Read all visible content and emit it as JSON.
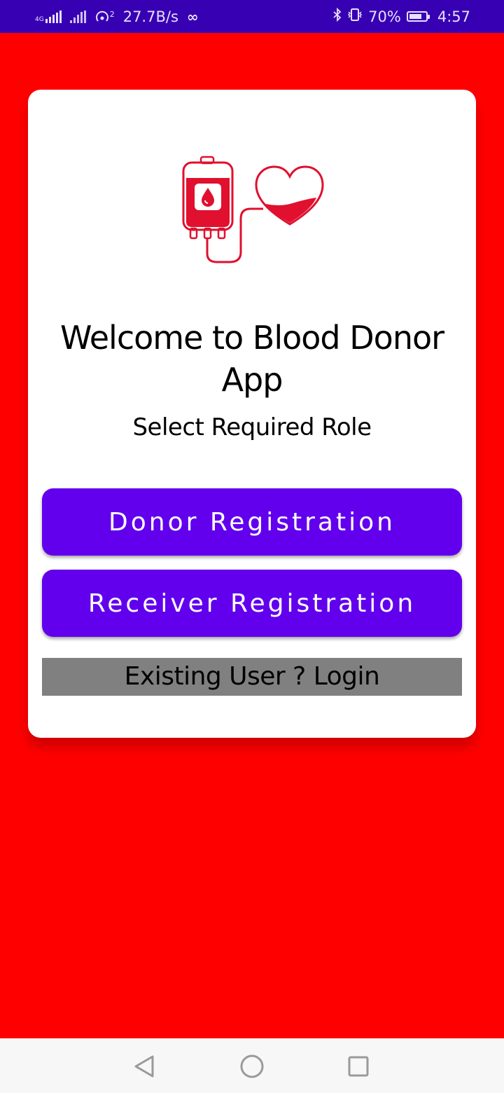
{
  "status_bar": {
    "network_type": "4G",
    "hotspot_count": "2",
    "speed": "27.7B/s",
    "battery": "70%",
    "time": "4:57",
    "icons": [
      "signal-icon",
      "signal-icon",
      "hotspot-icon",
      "infinity-icon",
      "bluetooth-icon",
      "vibrate-icon",
      "battery-icon"
    ]
  },
  "colors": {
    "background": "#ff0000",
    "status_bar": "#3700b3",
    "button": "#6200ee",
    "login_bg": "#808080",
    "logo_red": "#e0102e"
  },
  "card": {
    "logo_icon": "blood-donation-logo-icon",
    "title": "Welcome to Blood Donor App",
    "subtitle": "Select Required Role",
    "donor_button_label": "Donor Registration",
    "receiver_button_label": "Receiver Registration",
    "login_link_label": "Existing User ? Login"
  },
  "nav_bar": {
    "icons": [
      "back-icon",
      "home-icon",
      "recents-icon"
    ]
  }
}
